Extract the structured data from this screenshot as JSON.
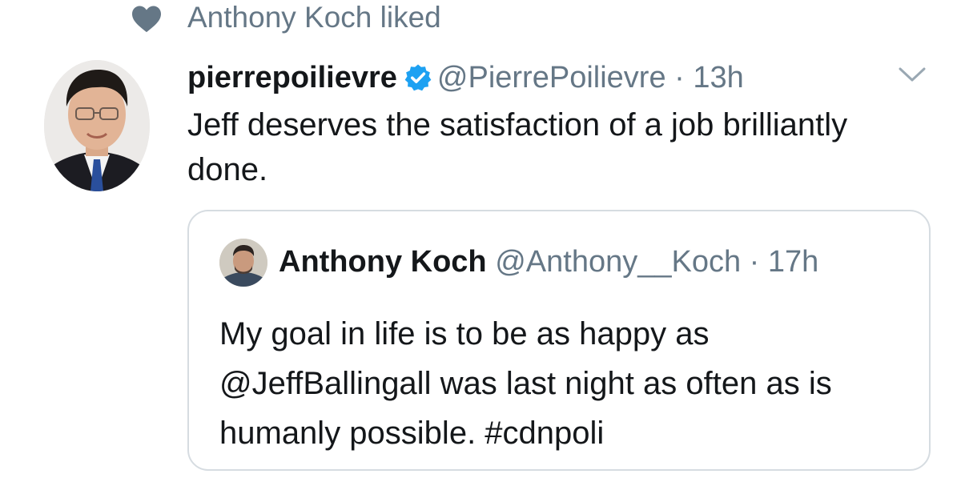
{
  "social_context": {
    "text": "Anthony Koch liked",
    "icon": "heart-icon"
  },
  "tweet": {
    "display_name": "pierrepoilievre",
    "verified_icon": "verified-badge-icon",
    "handle": "@PierrePoilievre",
    "separator": "·",
    "time": "13h",
    "text": "Jeff deserves the satisfaction of a job brilliantly done.",
    "menu_icon": "chevron-down-icon"
  },
  "quoted_tweet": {
    "display_name": "Anthony Koch",
    "handle": "@Anthony__Koch",
    "separator": "·",
    "time": "17h",
    "text": "My goal in life is to be as happy as @JeffBallingall was last night as often as is humanly possible. #cdnpoli"
  },
  "colors": {
    "secondary_text": "#657786",
    "primary_text": "#14171a",
    "verified_blue": "#1da1f2",
    "border": "#d6dce1"
  }
}
